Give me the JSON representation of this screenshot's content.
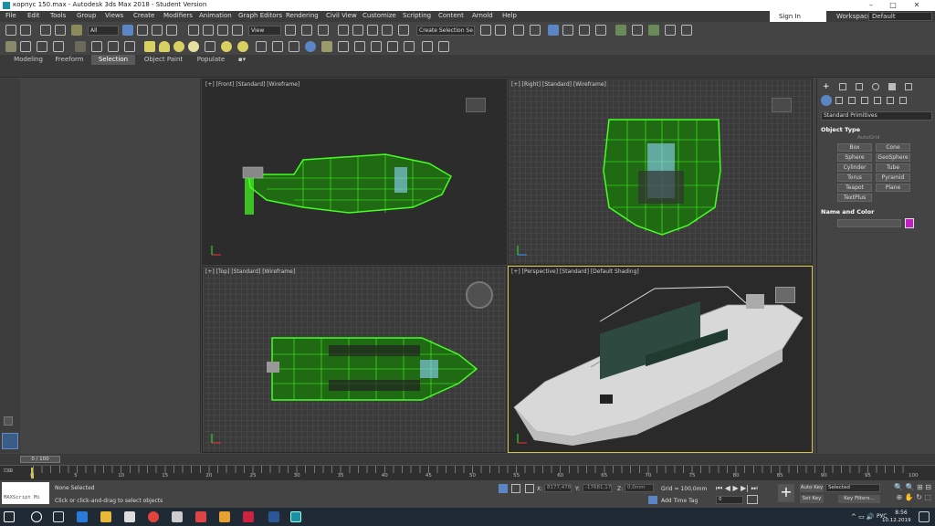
{
  "window": {
    "title": "корпус 150.max - Autodesk 3ds Max 2018 - Student Version",
    "controls": [
      "–",
      "□",
      "✕"
    ]
  },
  "menu": [
    "File",
    "Edit",
    "Tools",
    "Group",
    "Views",
    "Create",
    "Modifiers",
    "Animation",
    "Graph Editors",
    "Rendering",
    "Civil View",
    "Customize",
    "Scripting",
    "Content",
    "Arnold",
    "Help"
  ],
  "account": {
    "signin": "Sign In",
    "workspaces_label": "Workspaces:",
    "workspace": "Default"
  },
  "toolbar": {
    "filter": "All",
    "view": "View",
    "selection_set": "Create Selection Se"
  },
  "ribbon": {
    "tabs": [
      "Modeling",
      "Freeform",
      "Selection",
      "Object Paint",
      "Populate"
    ],
    "active": "Selection"
  },
  "viewports": {
    "front": "[+] [Front] [Standard] [Wireframe]",
    "right": "[+] [Right] [Standard] [Wireframe]",
    "top": "[+] [Top] [Standard] [Wireframe]",
    "perspective": "[+] [Perspective] [Standard] [Default Shading]"
  },
  "command_panel": {
    "category": "Standard Primitives",
    "object_type_header": "Object Type",
    "autogrid": "AutoGrid",
    "buttons": [
      "Box",
      "Cone",
      "Sphere",
      "GeoSphere",
      "Cylinder",
      "Tube",
      "Torus",
      "Pyramid",
      "Teapot",
      "Plane",
      "TextPlus"
    ],
    "name_color_header": "Name and Color",
    "color": "#c020c0"
  },
  "timeline": {
    "frame": "0 / 100",
    "ticks": [
      "0",
      "5",
      "10",
      "15",
      "20",
      "25",
      "30",
      "35",
      "40",
      "45",
      "50",
      "55",
      "60",
      "65",
      "70",
      "75",
      "80",
      "85",
      "90",
      "95",
      "100"
    ]
  },
  "status": {
    "maxscript": "MAXScript Mi",
    "selection": "None Selected",
    "prompt": "Click or click-and-drag to select objects",
    "x_label": "X:",
    "x_value": "8177,478n",
    "y_label": "Y:",
    "y_value": "-17681,17r",
    "z_label": "Z:",
    "z_value": "0,0mm",
    "grid": "Grid = 100,0mm",
    "add_time_tag": "Add Time Tag",
    "auto_key": "Auto Key",
    "set_key": "Set Key",
    "key_mode": "Selected",
    "key_filters": "Key Filters...",
    "frame_field": "0"
  },
  "taskbar": {
    "lang": "РУС",
    "time": "8:56",
    "date": "10.12.2019"
  },
  "colors": {
    "wire": "#44ff22",
    "selection_accent": "#d4c34a"
  }
}
